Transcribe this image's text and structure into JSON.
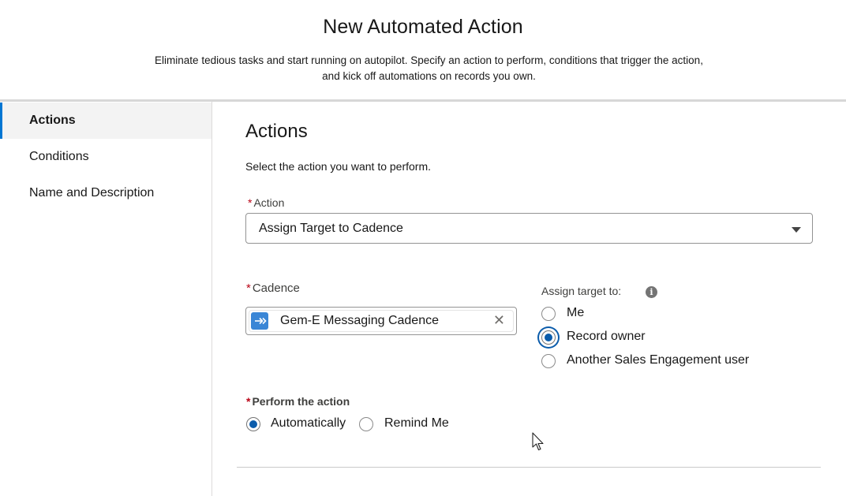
{
  "header": {
    "title": "New Automated Action",
    "subtitle": "Eliminate tedious tasks and start running on autopilot. Specify an action to perform, conditions that trigger the action, and kick off automations on records you own."
  },
  "sidebar": {
    "items": [
      {
        "label": "Actions",
        "active": true
      },
      {
        "label": "Conditions",
        "active": false
      },
      {
        "label": "Name and Description",
        "active": false
      }
    ]
  },
  "main": {
    "title": "Actions",
    "help_text": "Select the action you want to perform.",
    "action_field": {
      "required_mark": "*",
      "label": "Action",
      "value": "Assign Target to Cadence"
    },
    "cadence_field": {
      "required_mark": "*",
      "label": "Cadence",
      "selected_pill": "Gem-E Messaging Cadence",
      "pill_icon": "cadence-arrow-icon",
      "remove_glyph": "✕"
    },
    "assign_target": {
      "label": "Assign target to:",
      "info_glyph": "i",
      "options": [
        {
          "label": "Me",
          "checked": false
        },
        {
          "label": "Record owner",
          "checked": true
        },
        {
          "label": "Another Sales Engagement user",
          "checked": false
        }
      ]
    },
    "perform_action": {
      "required_mark": "*",
      "label": "Perform the action",
      "options": [
        {
          "label": "Automatically",
          "checked": true
        },
        {
          "label": "Remind Me",
          "checked": false
        }
      ]
    }
  },
  "colors": {
    "accent": "#0b5cab",
    "required": "#ba0517",
    "cadence_icon_bg": "#3a86d6"
  }
}
